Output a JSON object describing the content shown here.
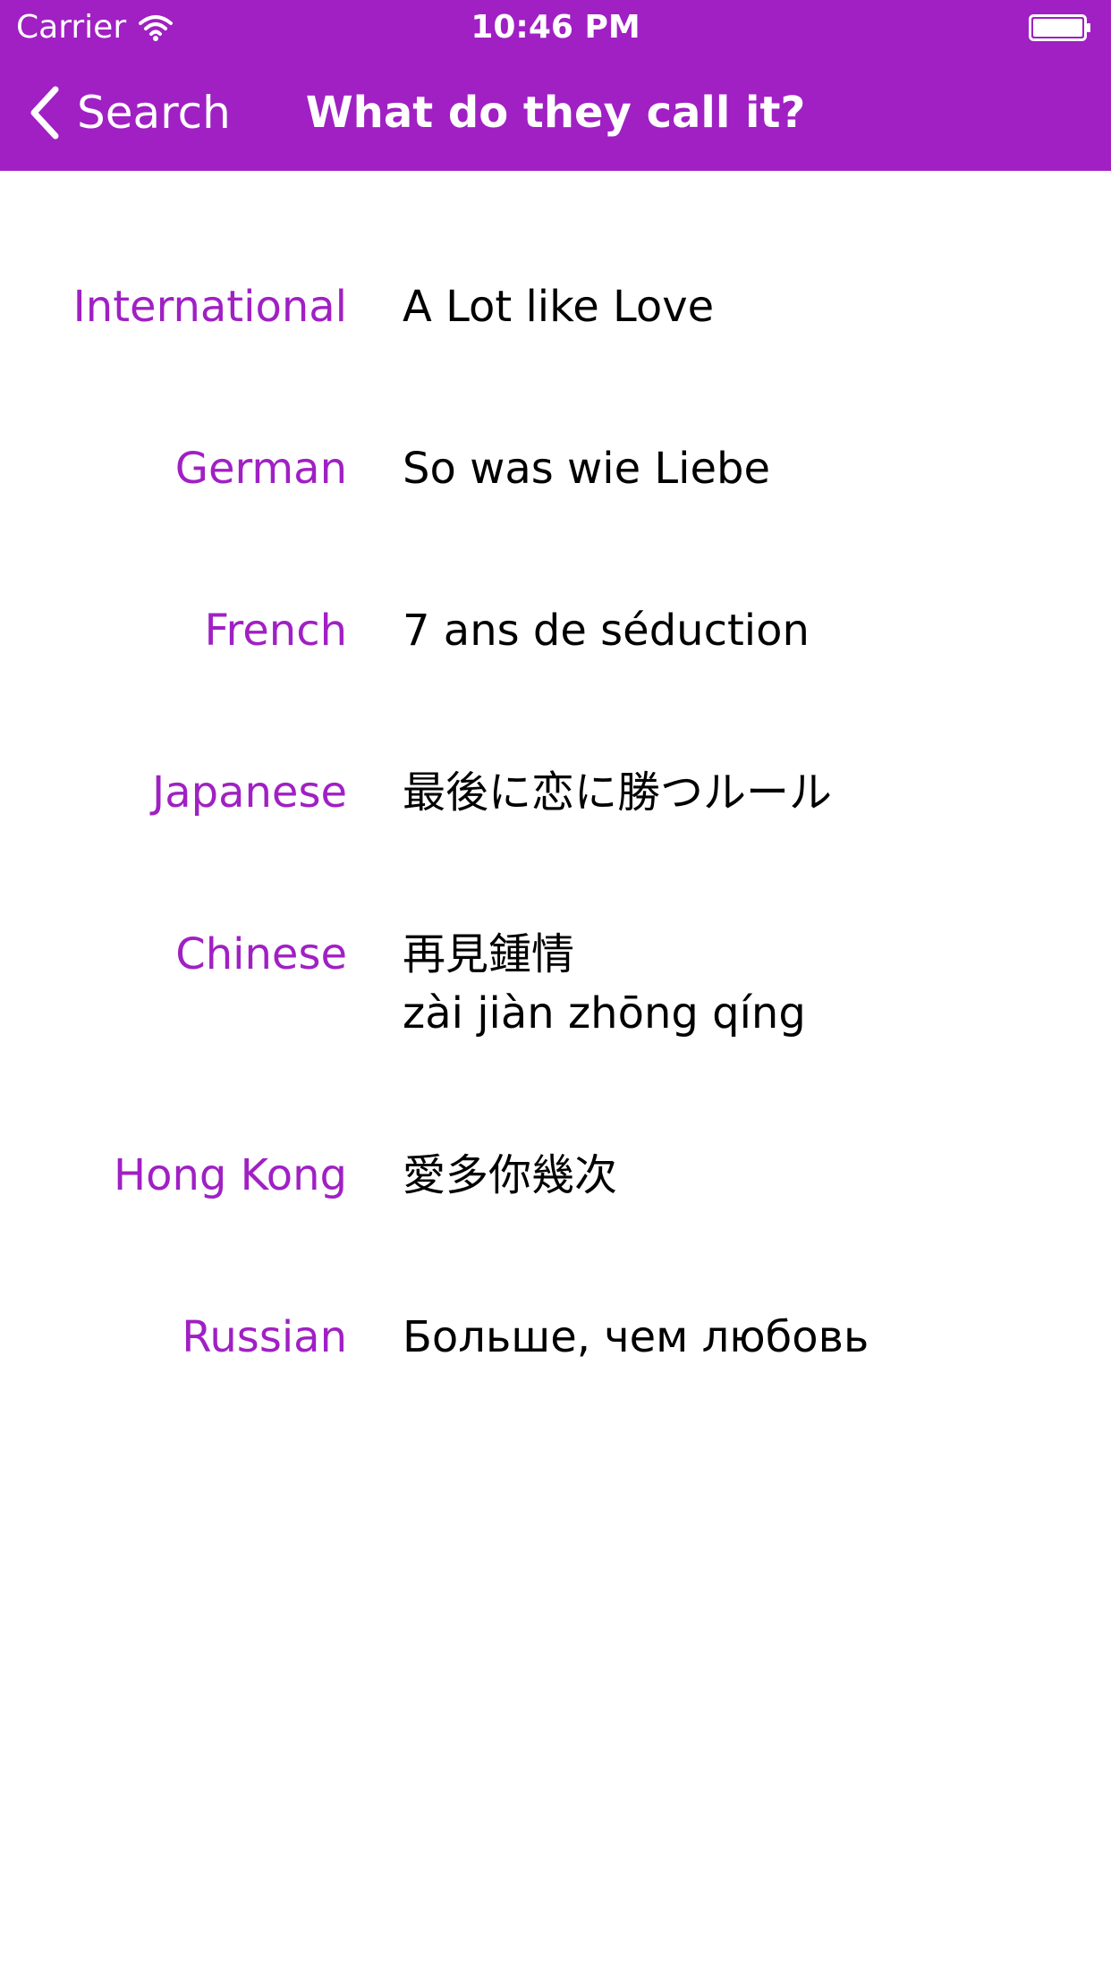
{
  "status_bar": {
    "carrier": "Carrier",
    "time": "10:46 PM",
    "icons": [
      "wifi-icon",
      "battery-icon"
    ]
  },
  "nav": {
    "back_label": "Search",
    "title": "What do they call it?",
    "back_icon": "chevron-left-icon"
  },
  "colors": {
    "accent": "#a020c4",
    "text": "#000000",
    "background": "#ffffff"
  },
  "rows": [
    {
      "language": "International",
      "lines": [
        "A Lot like Love"
      ]
    },
    {
      "language": "German",
      "lines": [
        "So was wie Liebe"
      ]
    },
    {
      "language": "French",
      "lines": [
        "7 ans de séduction"
      ]
    },
    {
      "language": "Japanese",
      "lines": [
        "最後に恋に勝つルール"
      ]
    },
    {
      "language": "Chinese",
      "lines": [
        "再見鍾情",
        "zài jiàn zhōng qíng"
      ]
    },
    {
      "language": "Hong Kong",
      "lines": [
        "愛多你幾次"
      ]
    },
    {
      "language": "Russian",
      "lines": [
        "Больше, чем любовь"
      ]
    }
  ]
}
